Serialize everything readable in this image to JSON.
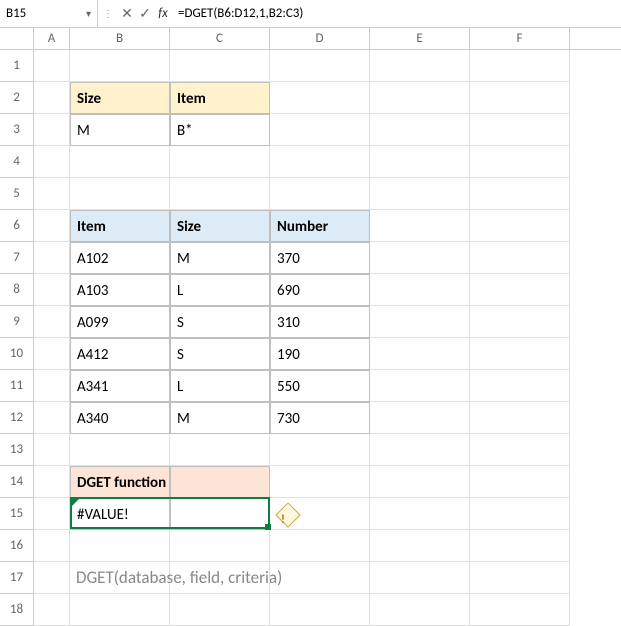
{
  "name_box": "B15",
  "formula_bar": "=DGET(B6:D12,1,B2:C3)",
  "fx_label": "fx",
  "columns": [
    "A",
    "B",
    "C",
    "D",
    "E",
    "F"
  ],
  "rows": [
    "1",
    "2",
    "3",
    "4",
    "5",
    "6",
    "7",
    "8",
    "9",
    "10",
    "11",
    "12",
    "13",
    "14",
    "15",
    "16",
    "17",
    "18"
  ],
  "criteria": {
    "headers": [
      "Size",
      "Item"
    ],
    "values": [
      "M",
      "B*"
    ]
  },
  "database": {
    "headers": [
      "Item",
      "Size",
      "Number"
    ],
    "rows": [
      [
        "A102",
        "M",
        "370"
      ],
      [
        "A103",
        "L",
        "690"
      ],
      [
        "A099",
        "S",
        "310"
      ],
      [
        "A412",
        "S",
        "190"
      ],
      [
        "A341",
        "L",
        "550"
      ],
      [
        "A340",
        "M",
        "730"
      ]
    ]
  },
  "result": {
    "title": "DGET function",
    "value": "#VALUE!"
  },
  "hint": "DGET(database, field, criteria)"
}
